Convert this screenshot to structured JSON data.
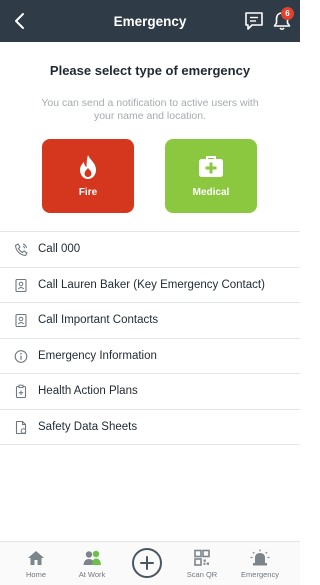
{
  "header": {
    "title": "Emergency",
    "notification_count": "6"
  },
  "main": {
    "heading": "Please select type of emergency",
    "subtext": "You can send a notification to active users with your name and location.",
    "tiles": [
      {
        "label": "Fire",
        "icon": "fire-icon",
        "color": "#d4371d"
      },
      {
        "label": "Medical",
        "icon": "medical-kit-icon",
        "color": "#8bc73f"
      }
    ]
  },
  "list": [
    {
      "label": "Call 000",
      "icon": "phone-icon"
    },
    {
      "label": "Call Lauren Baker (Key Emergency Contact)",
      "icon": "contact-card-icon"
    },
    {
      "label": "Call Important Contacts",
      "icon": "contact-card-icon"
    },
    {
      "label": "Emergency Information",
      "icon": "info-icon"
    },
    {
      "label": "Health Action Plans",
      "icon": "clipboard-plus-icon"
    },
    {
      "label": "Safety Data Sheets",
      "icon": "document-icon"
    }
  ],
  "tabbar": {
    "items": [
      {
        "label": "Home",
        "icon": "home-icon"
      },
      {
        "label": "At Work",
        "icon": "users-icon"
      },
      {
        "label": "",
        "icon": "plus-icon"
      },
      {
        "label": "Scan QR",
        "icon": "qr-icon"
      },
      {
        "label": "Emergency",
        "icon": "siren-icon"
      }
    ]
  },
  "colors": {
    "header_bg": "#2f3b47",
    "fire": "#d4371d",
    "medical": "#8bc73f",
    "badge": "#e0432f"
  }
}
